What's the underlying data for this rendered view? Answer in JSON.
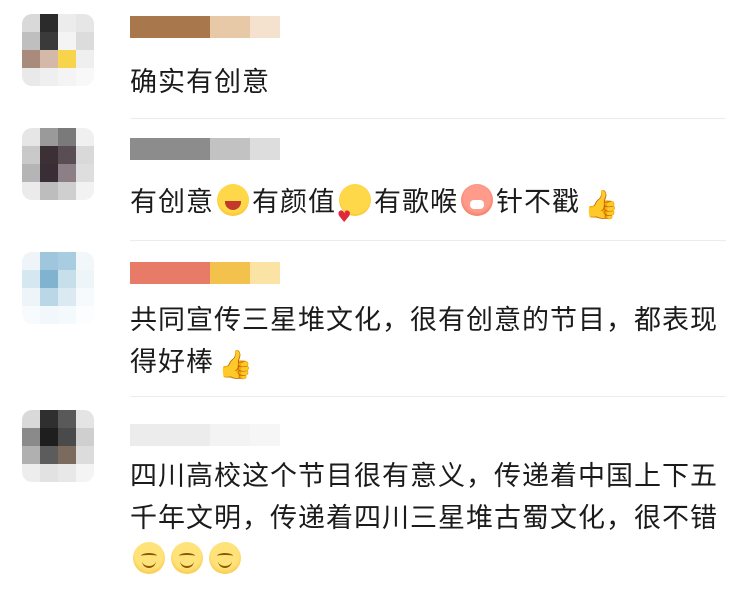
{
  "comments": [
    {
      "avatar_colors": [
        "#d9d9d9",
        "#2b2b2b",
        "#ececec",
        "#e6e6e6",
        "#bfbfbf",
        "#3a3a3a",
        "#f4f4f4",
        "#dcdcdc",
        "#a88b7a",
        "#d4b9a8",
        "#f7d44c",
        "#efefef",
        "#e9e9e9",
        "#efefef",
        "#f4f4f4",
        "#f8f8f8"
      ],
      "username_colors": [
        "#a8784c",
        "#e7c9a8",
        "#f4e2cf"
      ],
      "text_parts": [
        {
          "t": "确实有创意"
        }
      ]
    },
    {
      "avatar_colors": [
        "#e6e6e6",
        "#9a9a9a",
        "#7a7a7a",
        "#f0f0f0",
        "#c9c9c9",
        "#3c3035",
        "#5a4d53",
        "#d9d9d9",
        "#b5b5b5",
        "#3a2e36",
        "#8c7f86",
        "#dedede",
        "#ebebeb",
        "#bdbdbd",
        "#cfcfcf",
        "#f2f2f2"
      ],
      "username_colors": [
        "#8c8c8c",
        "#c2c2c2",
        "#dddddd"
      ],
      "text_parts": [
        {
          "t": "有创意"
        },
        {
          "emoji": "laugh-icon"
        },
        {
          "t": "有颜值"
        },
        {
          "emoji": "heart-face-icon"
        },
        {
          "t": "有歌喉"
        },
        {
          "emoji": "pig-laugh-icon"
        },
        {
          "t": "针不戳"
        },
        {
          "thumb": "👍"
        }
      ]
    },
    {
      "avatar_colors": [
        "#eef4f8",
        "#9fc6dc",
        "#a9cde0",
        "#f2f7fa",
        "#d5e7f1",
        "#7fb3d0",
        "#c7dfeb",
        "#eef5f9",
        "#eef5f9",
        "#b9d7e6",
        "#dbeaf2",
        "#f6fafc",
        "#f8fbfd",
        "#f1f7fa",
        "#f4f9fb",
        "#fbfdfe"
      ],
      "username_colors": [
        "#e87b67",
        "#f2c24c",
        "#fbe3a6"
      ],
      "text_parts": [
        {
          "t": "共同宣传三星堆文化，很有创意的节目，都表现得好棒"
        },
        {
          "thumb": "👍"
        }
      ]
    },
    {
      "avatar_colors": [
        "#d9d9d9",
        "#2f2f2f",
        "#595959",
        "#e4e4e4",
        "#8a8a8a",
        "#1e1e1e",
        "#4a4a4a",
        "#cfcfcf",
        "#b0b0b0",
        "#5c5c5c",
        "#7b6a5e",
        "#dcdcdc",
        "#ededed",
        "#e2e2e2",
        "#e8e8e8",
        "#f4f4f4"
      ],
      "username_colors": [
        "#ececec",
        "#f3f3f3",
        "#f6f6f6"
      ],
      "text_parts": [
        {
          "t": "四川高校这个节目很有意义，传递着中国上下五千年文明，传递着四川三星堆古蜀文化，很不错"
        },
        {
          "emoji": "smile-icon"
        },
        {
          "emoji": "smile-icon"
        },
        {
          "emoji": "smile-icon"
        }
      ]
    }
  ]
}
